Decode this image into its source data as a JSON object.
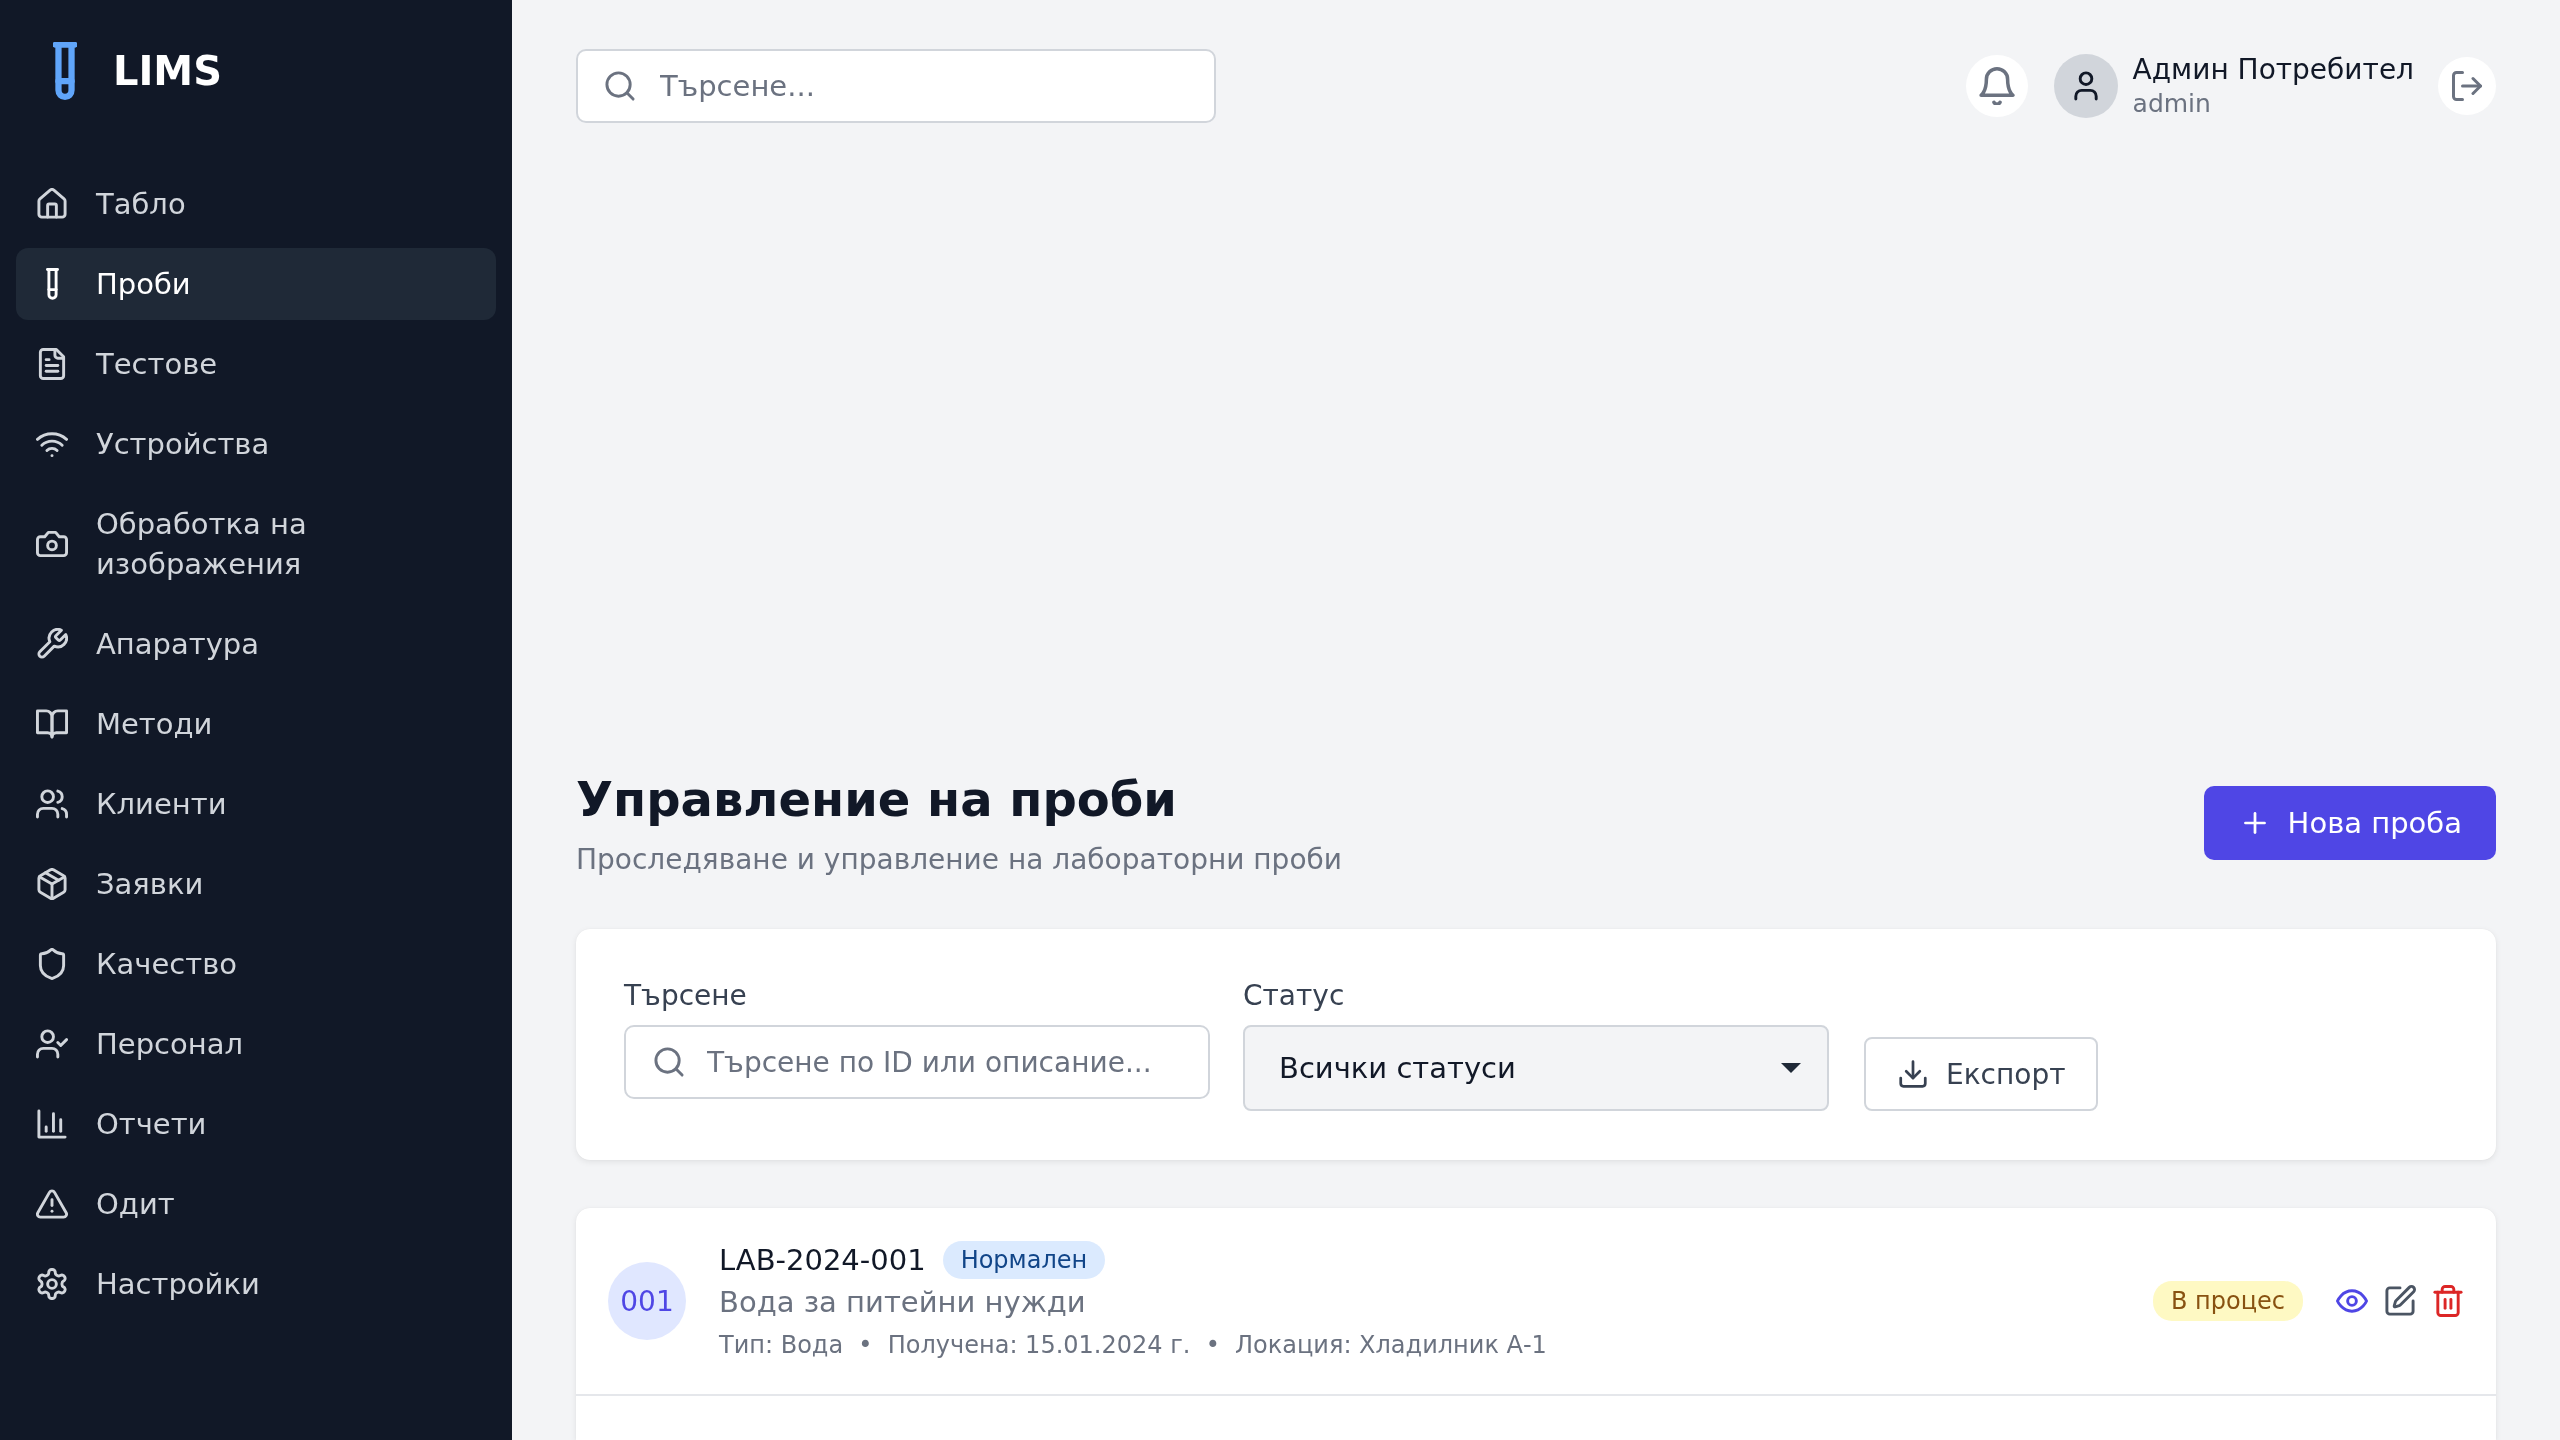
{
  "sidebar": {
    "logo": "LIMS",
    "items": [
      {
        "label": "Табло",
        "selected": false
      },
      {
        "label": "Проби",
        "selected": true
      },
      {
        "label": "Тестове",
        "selected": false
      },
      {
        "label": "Устройства",
        "selected": false
      },
      {
        "label": "Обработка на изображения",
        "selected": false
      },
      {
        "label": "Апаратура",
        "selected": false
      },
      {
        "label": "Методи",
        "selected": false
      },
      {
        "label": "Клиенти",
        "selected": false
      },
      {
        "label": "Заявки",
        "selected": false
      },
      {
        "label": "Качество",
        "selected": false
      },
      {
        "label": "Персонал",
        "selected": false
      },
      {
        "label": "Отчети",
        "selected": false
      },
      {
        "label": "Одит",
        "selected": false
      },
      {
        "label": "Настройки",
        "selected": false
      }
    ]
  },
  "topbar": {
    "search": {
      "placeholder": "Търсене..."
    },
    "user": {
      "name": "Админ Потребител",
      "username": "admin"
    }
  },
  "header": {
    "title": "Управление на проби",
    "subtitle": "Проследяване и управление на лабораторни проби",
    "new_button": "Нова проба"
  },
  "filters": {
    "search": {
      "label": "Търсене",
      "placeholder": "Търсене по ID или описание..."
    },
    "status": {
      "label": "Статус",
      "value": "Всички статуси"
    },
    "export_button": "Експорт"
  },
  "samples": [
    {
      "number": "001",
      "id": "LAB-2024-001",
      "priority": {
        "label": "Нормален",
        "color": "#dbeafe"
      },
      "description": "Вода за питейни нужди",
      "meta": "Тип: Вода  •  Получена: 15.01.2024 г.  •  Локация: Хладилник А-1",
      "status": {
        "label": "В процес",
        "color": "#fef9c3"
      }
    }
  ]
}
